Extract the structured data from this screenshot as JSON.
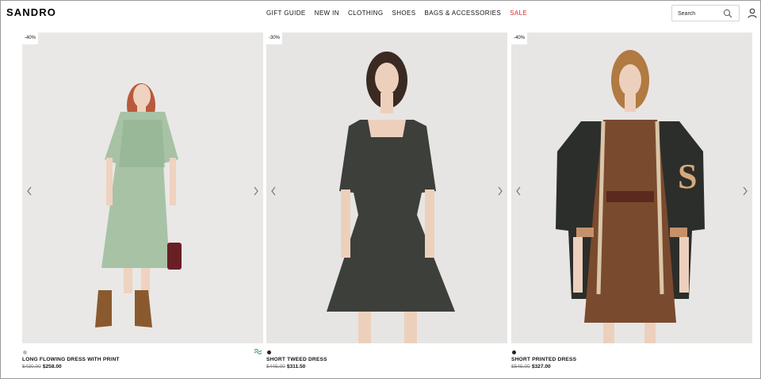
{
  "brand": {
    "logo": "SANDRO"
  },
  "nav": {
    "items": [
      {
        "label": "GIFT GUIDE",
        "key": "gift-guide"
      },
      {
        "label": "NEW IN",
        "key": "new-in"
      },
      {
        "label": "CLOTHING",
        "key": "clothing"
      },
      {
        "label": "SHOES",
        "key": "shoes"
      },
      {
        "label": "BAGS & ACCESSORIES",
        "key": "bags-accessories"
      },
      {
        "label": "SALE",
        "key": "sale"
      }
    ]
  },
  "search": {
    "placeholder": "Search",
    "icon": "search-icon"
  },
  "account": {
    "icon": "user-icon"
  },
  "products": [
    {
      "discount": "-40%",
      "name": "LONG FLOWING DRESS WITH PRINT",
      "old_price": "$430.00",
      "new_price": "$258.00",
      "swatch_color": "#b9b9b9",
      "eco_badge": true
    },
    {
      "discount": "-30%",
      "name": "SHORT TWEED DRESS",
      "old_price": "$445.00",
      "new_price": "$311.50",
      "swatch_color": "#222222",
      "eco_badge": false
    },
    {
      "discount": "-40%",
      "name": "SHORT PRINTED DRESS",
      "old_price": "$545.00",
      "new_price": "$327.00",
      "swatch_color": "#222222",
      "eco_badge": false
    }
  ],
  "colors": {
    "sale": "#d2322d",
    "eco": "#3a9a4a"
  }
}
